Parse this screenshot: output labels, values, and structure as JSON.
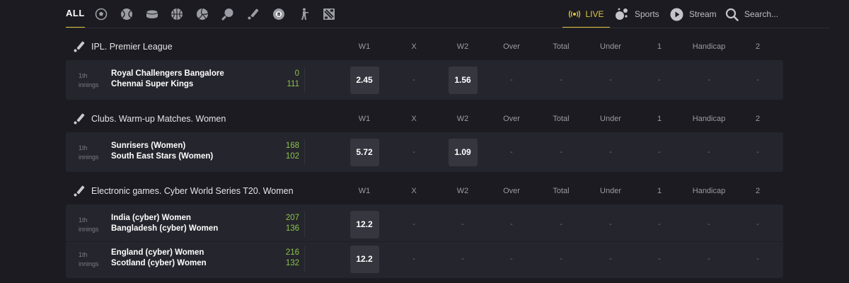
{
  "nav": {
    "all_label": "ALL",
    "sport_icons": [
      "football-icon",
      "tennis-icon",
      "hockey-icon",
      "basketball-icon",
      "volleyball-icon",
      "table-tennis-icon",
      "cricket-icon",
      "billiards-icon",
      "shooter-icon",
      "dota-icon"
    ],
    "live_label": "LIVE",
    "sports_label": "Sports",
    "stream_label": "Stream",
    "search_placeholder": "Search..."
  },
  "columns": [
    "W1",
    "X",
    "W2",
    "Over",
    "Total",
    "Under",
    "1",
    "Handicap",
    "2"
  ],
  "sections": [
    {
      "title": "IPL. Premier League",
      "matches": [
        {
          "innings": [
            "1th",
            "innings"
          ],
          "team1": "Royal Challengers Bangalore",
          "team2": "Chennai Super Kings",
          "score1": "0",
          "score2": "111",
          "odds": [
            "2.45",
            "-",
            "1.56",
            "-",
            "-",
            "-",
            "-",
            "-",
            "-"
          ]
        }
      ]
    },
    {
      "title": "Clubs. Warm-up Matches. Women",
      "matches": [
        {
          "innings": [
            "1th",
            "innings"
          ],
          "team1": "Sunrisers (Women)",
          "team2": "South East Stars (Women)",
          "score1": "168",
          "score2": "102",
          "odds": [
            "5.72",
            "-",
            "1.09",
            "-",
            "-",
            "-",
            "-",
            "-",
            "-"
          ]
        }
      ]
    },
    {
      "title": "Electronic games. Cyber World Series T20. Women",
      "matches": [
        {
          "innings": [
            "1th",
            "innings"
          ],
          "team1": "India (cyber) Women",
          "team2": "Bangladesh (cyber) Women",
          "score1": "207",
          "score2": "136",
          "odds": [
            "12.2",
            "-",
            "-",
            "-",
            "-",
            "-",
            "-",
            "-",
            "-"
          ]
        },
        {
          "innings": [
            "1th",
            "innings"
          ],
          "team1": "England (cyber) Women",
          "team2": "Scotland (cyber) Women",
          "score1": "216",
          "score2": "132",
          "odds": [
            "12.2",
            "-",
            "-",
            "-",
            "-",
            "-",
            "-",
            "-",
            "-"
          ]
        }
      ]
    }
  ],
  "colors": {
    "accent": "#e0c340",
    "score": "#8bc34a",
    "background": "#1b1b21",
    "panel": "#25252d",
    "odd_button": "#36363f"
  }
}
